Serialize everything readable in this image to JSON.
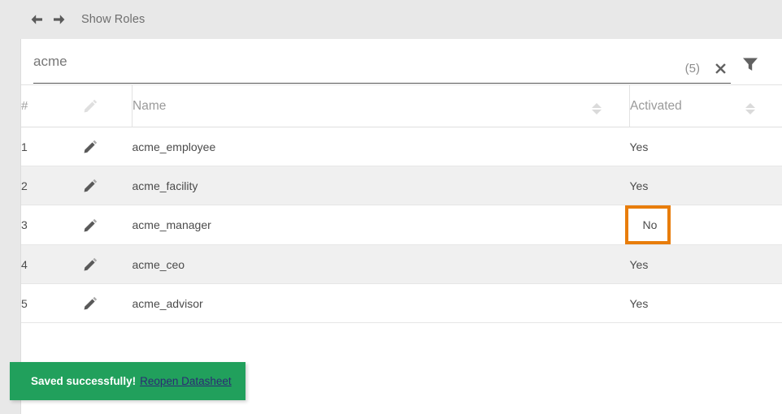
{
  "topbar": {
    "back_icon": "arrow-left-icon",
    "forward_icon": "arrow-right-icon",
    "breadcrumb": "Show Roles"
  },
  "search": {
    "value": "acme",
    "placeholder": "",
    "result_count": "(5)",
    "clear_icon": "close-icon",
    "filter_icon": "filter-funnel-icon"
  },
  "table": {
    "headers": {
      "number": "#",
      "edit_icon": "pencil-icon",
      "name": "Name",
      "activated": "Activated"
    },
    "rows": [
      {
        "num": "1",
        "name": "acme_employee",
        "activated": "Yes",
        "highlight": false
      },
      {
        "num": "2",
        "name": "acme_facility",
        "activated": "Yes",
        "highlight": false
      },
      {
        "num": "3",
        "name": "acme_manager",
        "activated": "No",
        "highlight": true
      },
      {
        "num": "4",
        "name": "acme_ceo",
        "activated": "Yes",
        "highlight": false
      },
      {
        "num": "5",
        "name": "acme_advisor",
        "activated": "Yes",
        "highlight": false
      }
    ]
  },
  "toast": {
    "message": "Saved successfully!",
    "link": "Reopen Datasheet",
    "background_color": "#21a05c",
    "link_color": "#2b2b73"
  },
  "colors": {
    "page_background": "#e8e8e8",
    "card_background": "#ffffff",
    "row_alt_background": "#f0f0f0",
    "highlight_border": "#e87d0b"
  }
}
